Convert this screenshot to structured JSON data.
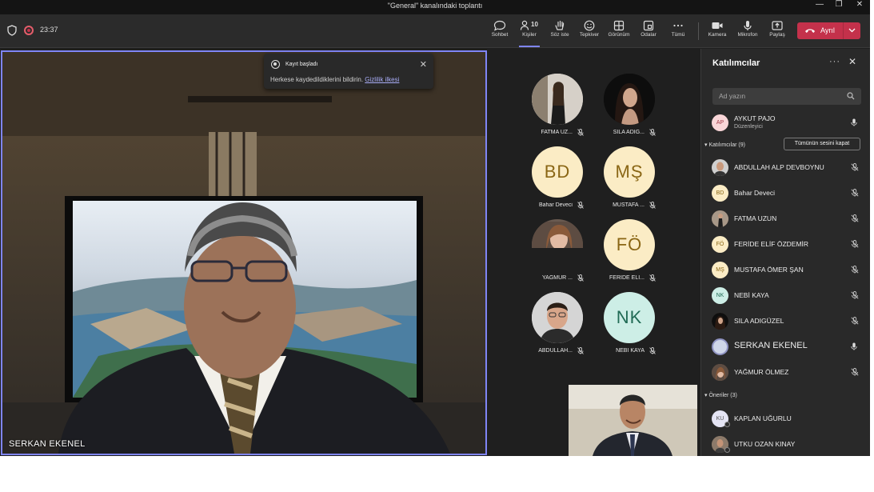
{
  "window": {
    "title": "\"General\" kanalındaki toplantı"
  },
  "meeting": {
    "timer": "23:37"
  },
  "toolbar": {
    "people_count": "10",
    "items": [
      {
        "label": "Sohbet",
        "icon": "chat-icon"
      },
      {
        "label": "Kişiler",
        "icon": "people-icon"
      },
      {
        "label": "Söz iste",
        "icon": "raise-hand-icon"
      },
      {
        "label": "Tepkiver",
        "icon": "reactions-icon"
      },
      {
        "label": "Görünüm",
        "icon": "view-icon"
      },
      {
        "label": "Odalar",
        "icon": "rooms-icon"
      },
      {
        "label": "Tümü",
        "icon": "more-icon"
      },
      {
        "label": "Kamera",
        "icon": "camera-icon"
      },
      {
        "label": "Mikrofon",
        "icon": "microphone-icon"
      },
      {
        "label": "Paylaş",
        "icon": "share-icon"
      }
    ],
    "leave_label": "Ayrıl"
  },
  "notification": {
    "title": "Kayıt başladı",
    "message": "Herkese kaydedildiklerini bildirin.",
    "link": "Gizlilik ilkesi"
  },
  "main_video": {
    "name": "SERKAN EKENEL"
  },
  "gallery": [
    {
      "initials": "",
      "name": "FATMA UZ...",
      "has_photo": true
    },
    {
      "initials": "",
      "name": "SILA ADIG...",
      "has_photo": true
    },
    {
      "initials": "BD",
      "name": "Bahar Deveci",
      "has_photo": false
    },
    {
      "initials": "MŞ",
      "name": "MUSTAFA ...",
      "has_photo": false
    },
    {
      "initials": "",
      "name": "YAĞMUR ...",
      "has_photo": true
    },
    {
      "initials": "FÖ",
      "name": "FERİDE ELİ...",
      "has_photo": false
    },
    {
      "initials": "",
      "name": "ABDULLAH...",
      "has_photo": true
    },
    {
      "initials": "NK",
      "name": "NEBİ KAYA",
      "has_photo": false
    }
  ],
  "panel": {
    "title": "Katılımcılar",
    "search_placeholder": "Ad yazın",
    "organizer": {
      "initials": "AP",
      "name": "AYKUT PAJO",
      "role": "Düzenleyici"
    },
    "participants_section": "Katılımcılar (9)",
    "mute_all": "Tümünün sesini kapat",
    "participants": [
      {
        "initials": "",
        "name": "ABDULLAH ALP DEVBOYNU"
      },
      {
        "initials": "BD",
        "name": "Bahar Deveci"
      },
      {
        "initials": "",
        "name": "FATMA UZUN"
      },
      {
        "initials": "FÖ",
        "name": "FERİDE ELİF ÖZDEMİR"
      },
      {
        "initials": "MŞ",
        "name": "MUSTAFA ÖMER ŞAN"
      },
      {
        "initials": "NK",
        "name": "NEBİ KAYA"
      },
      {
        "initials": "",
        "name": "SILA ADIGÜZEL"
      },
      {
        "initials": "",
        "name": "SERKAN EKENEL"
      },
      {
        "initials": "",
        "name": "YAĞMUR ÖLMEZ"
      }
    ],
    "suggestions_section": "Öneriler (3)",
    "suggestions": [
      {
        "initials": "KU",
        "name": "KAPLAN UĞURLU"
      },
      {
        "initials": "",
        "name": "UTKU OZAN KINAY"
      }
    ]
  },
  "colors": {
    "accent": "#7f85f5",
    "leave": "#c4314b",
    "background": "#1f1f1f"
  }
}
